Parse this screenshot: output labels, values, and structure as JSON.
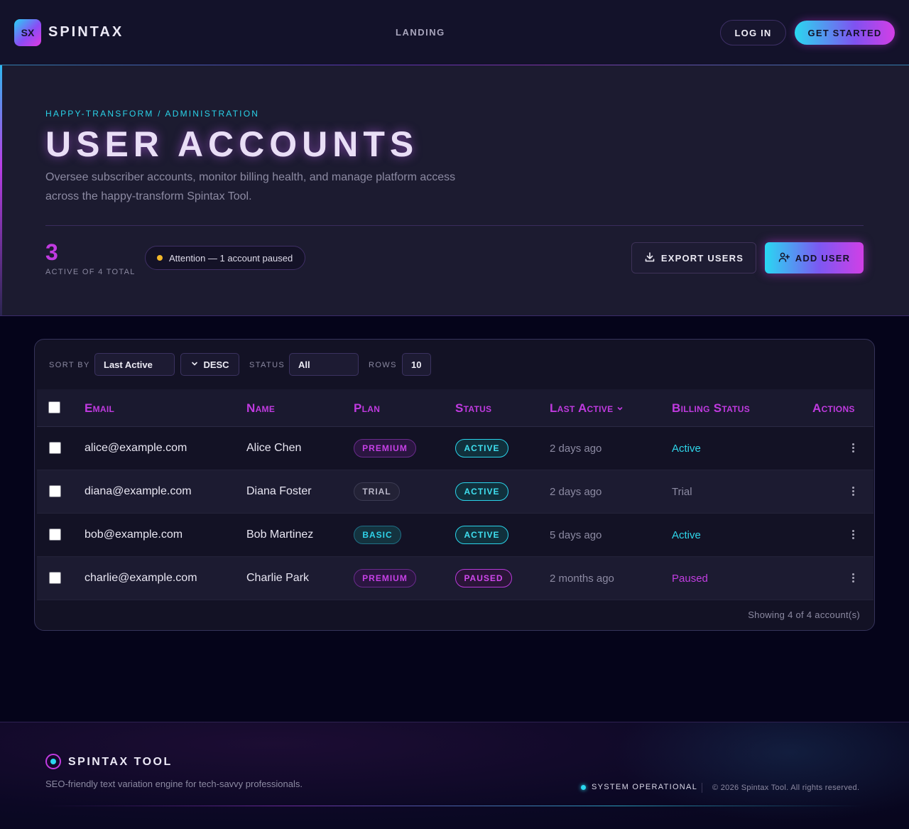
{
  "nav": {
    "logo_mark": "SX",
    "logo_text": "SPINTAX",
    "link": "LANDING",
    "login_label": "LOG IN",
    "start_label": "GET STARTED"
  },
  "hero": {
    "breadcrumb": "HAPPY-TRANSFORM / ADMINISTRATION",
    "title": "USER ACCOUNTS",
    "description": "Oversee subscriber accounts, monitor billing health, and manage platform access across the happy-transform Spintax Tool.",
    "active_count": "3",
    "active_label": "ACTIVE OF 4 TOTAL",
    "attention": "Attention — 1 account paused",
    "export_label": "EXPORT USERS",
    "add_label": "ADD USER"
  },
  "toolbar": {
    "sort_by_label": "SORT BY",
    "sort_by_value": "Last Active",
    "order_value": "DESC",
    "status_label": "STATUS",
    "status_value": "All",
    "rows_label": "ROWS",
    "rows_value": "10"
  },
  "table": {
    "headers": {
      "email": "Email",
      "name": "Name",
      "plan": "Plan",
      "status": "Status",
      "last_active": "Last Active",
      "billing": "Billing Status",
      "actions": "Actions"
    },
    "rows": [
      {
        "email": "alice@example.com",
        "name": "Alice Chen",
        "plan": "PREMIUM",
        "status": "ACTIVE",
        "last_active": "2 days ago",
        "billing": "Active"
      },
      {
        "email": "diana@example.com",
        "name": "Diana Foster",
        "plan": "TRIAL",
        "status": "ACTIVE",
        "last_active": "2 days ago",
        "billing": "Trial"
      },
      {
        "email": "bob@example.com",
        "name": "Bob Martinez",
        "plan": "BASIC",
        "status": "ACTIVE",
        "last_active": "5 days ago",
        "billing": "Active"
      },
      {
        "email": "charlie@example.com",
        "name": "Charlie Park",
        "plan": "PREMIUM",
        "status": "PAUSED",
        "last_active": "2 months ago",
        "billing": "Paused"
      }
    ],
    "footnote": "Showing 4 of 4 account(s)"
  },
  "footer": {
    "title": "SPINTAX TOOL",
    "tagline": "SEO-friendly text variation engine for tech-savvy professionals.",
    "status": "SYSTEM OPERATIONAL",
    "copyright": "© 2026 Spintax Tool. All rights reserved."
  },
  "colors": {
    "accent_magenta": "#c13ae0",
    "accent_cyan": "#2ad8f0",
    "attention_yellow": "#f1b72a"
  }
}
